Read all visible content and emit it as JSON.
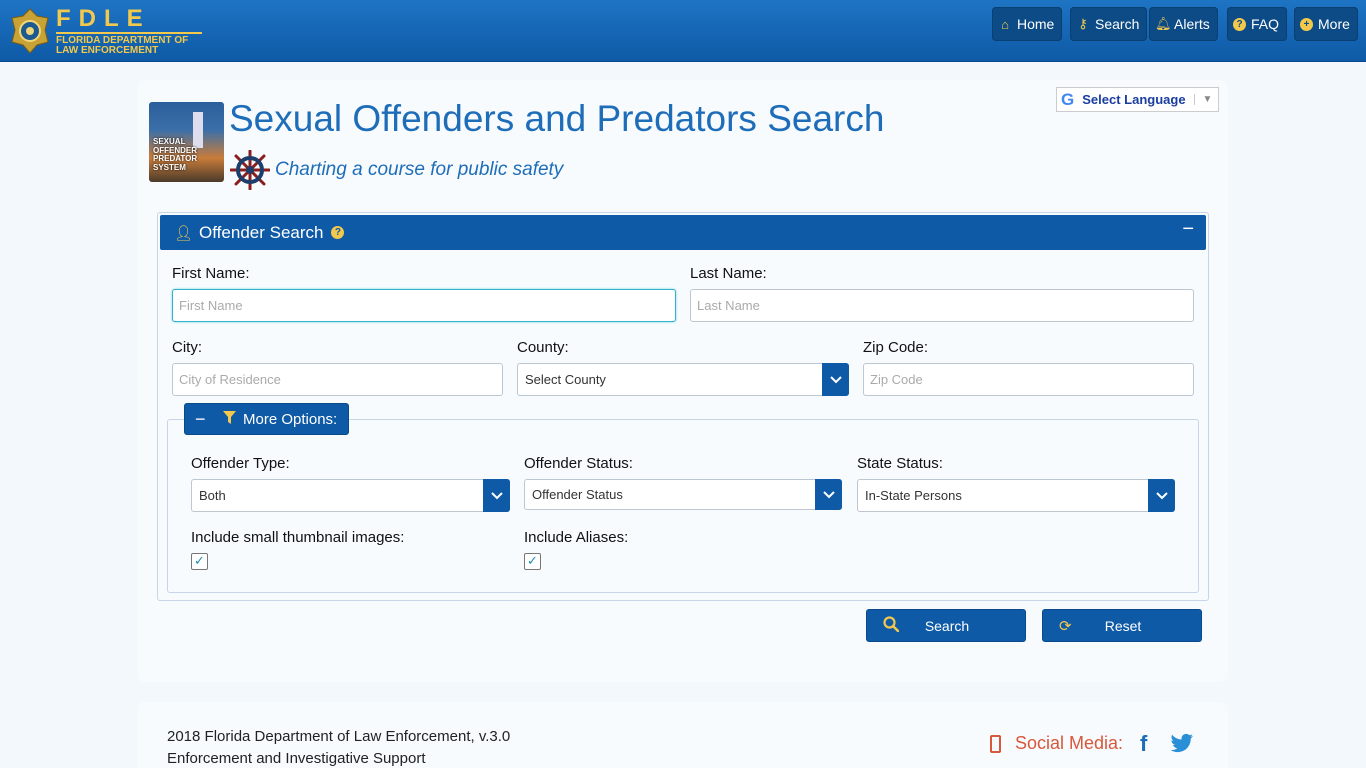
{
  "header": {
    "logo_abbr": "FDLE",
    "logo_line1": "FLORIDA DEPARTMENT OF",
    "logo_line2": "LAW ENFORCEMENT",
    "nav": [
      {
        "label": "Home",
        "icon": "home-icon"
      },
      {
        "label": "Search",
        "icon": "key-search-icon"
      },
      {
        "label": "Alerts",
        "icon": "bell-icon"
      },
      {
        "label": "FAQ",
        "icon": "question-icon"
      },
      {
        "label": "More",
        "icon": "plus-circle-icon"
      }
    ]
  },
  "translate": {
    "label": "Select Language"
  },
  "page": {
    "title": "Sexual Offenders and Predators Search",
    "subtitle": "Charting a course for public safety",
    "logo_text": [
      "SEXUAL",
      "OFFENDER",
      "PREDATOR",
      "SYSTEM"
    ]
  },
  "panel": {
    "title": "Offender Search",
    "first_name": {
      "label": "First Name:",
      "placeholder": "First Name",
      "value": ""
    },
    "last_name": {
      "label": "Last Name:",
      "placeholder": "Last Name",
      "value": ""
    },
    "city": {
      "label": "City:",
      "placeholder": "City of Residence",
      "value": ""
    },
    "county": {
      "label": "County:",
      "selected": "Select County"
    },
    "zip": {
      "label": "Zip Code:",
      "placeholder": "Zip Code",
      "value": ""
    },
    "more_options": {
      "label": "More Options:",
      "offender_type": {
        "label": "Offender Type:",
        "selected": "Both"
      },
      "offender_status": {
        "label": "Offender Status:",
        "selected": "Offender Status"
      },
      "state_status": {
        "label": "State Status:",
        "selected": "In-State Persons"
      },
      "thumbnails": {
        "label": "Include small thumbnail images:",
        "checked": true
      },
      "aliases": {
        "label": "Include Aliases:",
        "checked": true
      }
    },
    "search_label": "Search",
    "reset_label": "Reset"
  },
  "footer": {
    "line1": "2018 Florida Department of Law Enforcement, v.3.0",
    "line2": "Enforcement and Investigative Support",
    "social_label": "Social Media:",
    "social_icons": [
      "facebook-icon",
      "twitter-icon"
    ]
  },
  "colors": {
    "primary": "#0e5aa6",
    "accent": "#f2c94c",
    "title": "#1e6db8",
    "social": "#d9573a"
  }
}
